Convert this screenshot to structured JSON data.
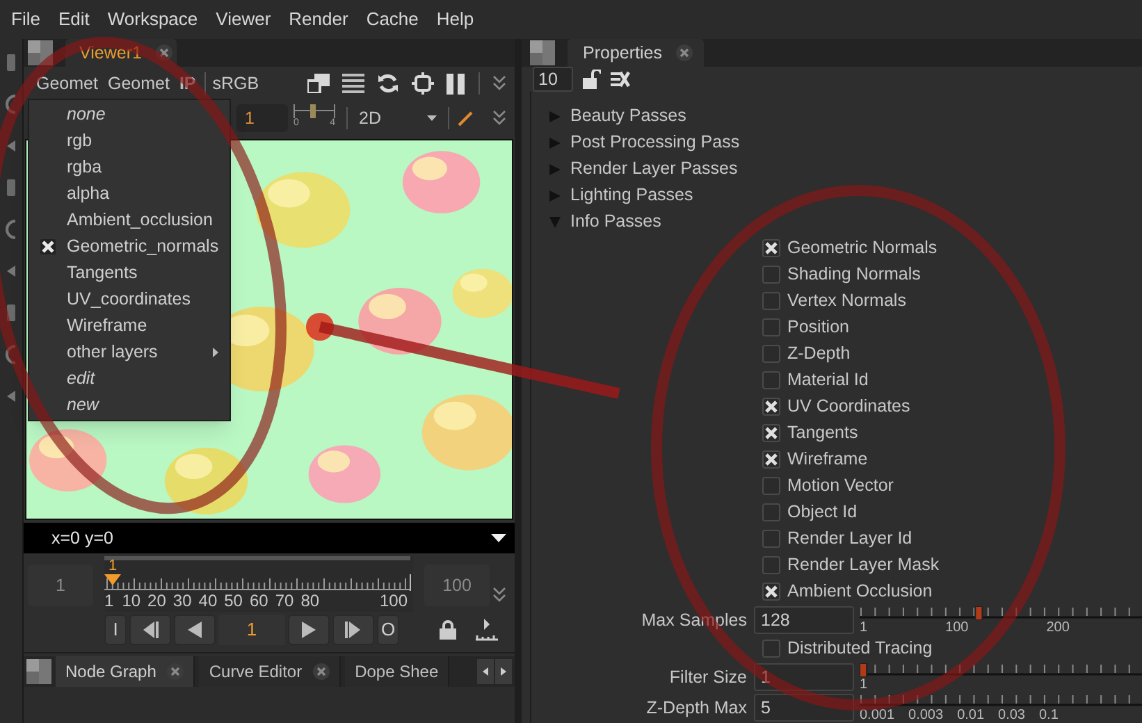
{
  "menu_bar": [
    "File",
    "Edit",
    "Workspace",
    "Viewer",
    "Render",
    "Cache",
    "Help"
  ],
  "viewer": {
    "tab": {
      "label": "Viewer1",
      "selected": true
    },
    "toolbar": {
      "layer_button": "Geomet",
      "channel_button": "Geomet",
      "ip_button": "IP",
      "colorspace": "sRGB"
    },
    "frame_field": "1",
    "gain_slider": {
      "min_label": "0",
      "max_label": "4",
      "level": 0.45
    },
    "view_mode": "2D",
    "layer_menu": [
      {
        "label": "none",
        "kind": "special",
        "checked": false
      },
      {
        "label": "rgb",
        "kind": "layer",
        "checked": false
      },
      {
        "label": "rgba",
        "kind": "layer",
        "checked": false
      },
      {
        "label": "alpha",
        "kind": "layer",
        "checked": false
      },
      {
        "label": "Ambient_occlusion",
        "kind": "layer",
        "checked": false
      },
      {
        "label": "Geometric_normals",
        "kind": "layer",
        "checked": true
      },
      {
        "label": "Tangents",
        "kind": "layer",
        "checked": false
      },
      {
        "label": "UV_coordinates",
        "kind": "layer",
        "checked": false
      },
      {
        "label": "Wireframe",
        "kind": "layer",
        "checked": false
      },
      {
        "label": "other layers",
        "kind": "submenu",
        "checked": false
      },
      {
        "label": "edit",
        "kind": "special",
        "checked": false
      },
      {
        "label": "new",
        "kind": "special",
        "checked": false
      }
    ],
    "info": "x=0 y=0",
    "timeline": {
      "start": "1",
      "end": "100",
      "playhead": {
        "label": "1",
        "level": 0
      },
      "tick_labels": [
        "1",
        "10",
        "20",
        "30",
        "40",
        "50",
        "60",
        "70",
        "80",
        "100"
      ]
    },
    "playback": {
      "in_button": "I",
      "frame": "1",
      "out_button": "O"
    }
  },
  "bottom_tabs": [
    {
      "label": "Node Graph",
      "selected": true
    },
    {
      "label": "Curve Editor",
      "selected": false
    },
    {
      "label": "Dope Shee",
      "selected": false
    }
  ],
  "properties": {
    "tab": {
      "label": "Properties",
      "selected": true
    },
    "max_panels": "10",
    "sections": [
      {
        "label": "Beauty Passes",
        "expanded": false
      },
      {
        "label": "Post Processing Pass",
        "expanded": false
      },
      {
        "label": "Render Layer Passes",
        "expanded": false
      },
      {
        "label": "Lighting Passes",
        "expanded": false
      },
      {
        "label": "Info Passes",
        "expanded": true,
        "children": [
          {
            "label": "Geometric Normals",
            "checked": true
          },
          {
            "label": "Shading Normals",
            "checked": false
          },
          {
            "label": "Vertex Normals",
            "checked": false
          },
          {
            "label": "Position",
            "checked": false
          },
          {
            "label": "Z-Depth",
            "checked": false
          },
          {
            "label": "Material Id",
            "checked": false
          },
          {
            "label": "UV Coordinates",
            "checked": true
          },
          {
            "label": "Tangents",
            "checked": true
          },
          {
            "label": "Wireframe",
            "checked": true
          },
          {
            "label": "Motion Vector",
            "checked": false
          },
          {
            "label": "Object Id",
            "checked": false
          },
          {
            "label": "Render Layer Id",
            "checked": false
          },
          {
            "label": "Render Layer Mask",
            "checked": false
          },
          {
            "label": "Ambient Occlusion",
            "checked": true
          }
        ]
      }
    ],
    "params": [
      {
        "kind": "slider",
        "label": "Max Samples",
        "value": "128",
        "level": 0.42,
        "ticks": [
          "1",
          "100",
          "200"
        ]
      },
      {
        "kind": "checkbox",
        "label": "Distributed Tracing",
        "checked": false
      },
      {
        "kind": "slider",
        "label": "Filter Size",
        "value": "1",
        "level": 0,
        "ticks": [
          "1"
        ]
      },
      {
        "kind": "slider",
        "label": "Z-Depth Max",
        "value": "5",
        "ticks": [
          "0.001",
          "0.003",
          "0.01",
          "0.03",
          "0.1"
        ]
      }
    ]
  }
}
